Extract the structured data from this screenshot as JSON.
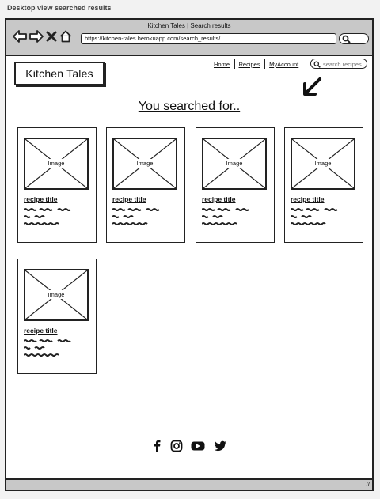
{
  "caption": "Desktop view searched results",
  "window": {
    "title": "Kitchen Tales | Search results"
  },
  "browser": {
    "url": "https://kitchen-tales.herokuapp.com/search_results/"
  },
  "site": {
    "logo": "Kitchen Tales",
    "nav": [
      "Home",
      "Recipes",
      "MyAccount"
    ],
    "search_placeholder": "search recipes"
  },
  "heading": "You searched for..",
  "results": [
    {
      "image_label": "Image",
      "title": "recipe title"
    },
    {
      "image_label": "Image",
      "title": "recipe title"
    },
    {
      "image_label": "Image",
      "title": "recipe title"
    },
    {
      "image_label": "Image",
      "title": "recipe title"
    },
    {
      "image_label": "Image",
      "title": "recipe title"
    }
  ],
  "social_icons": [
    "facebook-icon",
    "instagram-icon",
    "youtube-icon",
    "twitter-icon"
  ]
}
